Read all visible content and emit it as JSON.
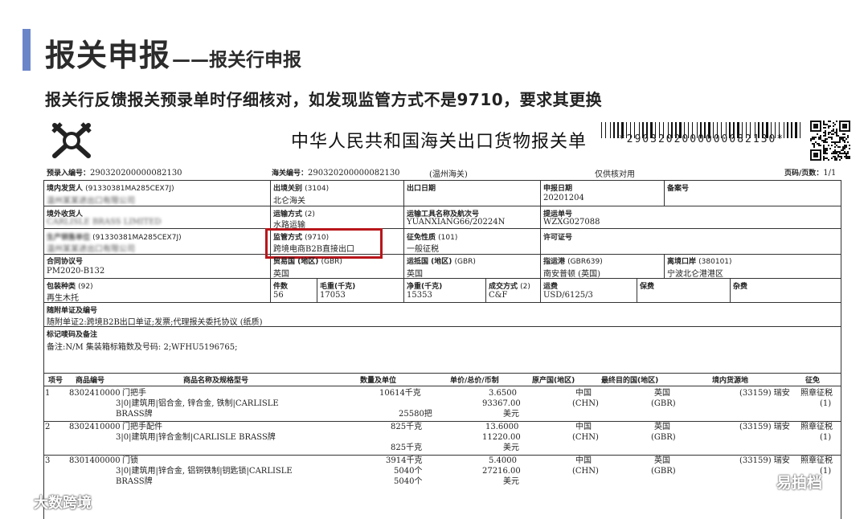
{
  "slide": {
    "title_main": "报关申报",
    "title_sub": "——报关行申报",
    "instruction": "报关行反馈报关预录单时仔细核对，如发现监管方式不是9710，要求其更换"
  },
  "doc": {
    "title": "中华人民共和国海关出口货物报关单",
    "barcode_text": "*2903202000000082130*",
    "prerecord_label": "预录入编号：",
    "prerecord_no": "290320200000082130",
    "customs_no_label": "海关编号：",
    "customs_no": "290320200000082130",
    "customs_office": "(温州海关)",
    "notice": "仅供核对用",
    "page_label": "页码/页数：",
    "page_value": "1/1",
    "fields": {
      "domestic_consignor_label": "境内发货人",
      "domestic_consignor_code": "(91330381MA285CEX7J)",
      "domestic_consignor_name": "温州某某进出口有限公司",
      "export_port_label": "出境关别",
      "export_port_code": "(3104)",
      "export_port_value": "北仑海关",
      "export_date_label": "出口日期",
      "declare_date_label": "申报日期",
      "declare_date_value": "20201204",
      "record_no_label": "备案号",
      "overseas_consignee_label": "境外收货人",
      "overseas_consignee_name": "CARLISLE BRASS LIMITED",
      "transport_mode_label": "运输方式",
      "transport_mode_code": "(2)",
      "transport_mode_value": "水路运输",
      "vessel_label": "运输工具名称及航次号",
      "vessel_value": "YUANXIANG66/20224N",
      "bl_label": "提运单号",
      "bl_value": "WZXG027088",
      "producer_label": "生产销售单位",
      "producer_code": "(91330381MA285CEX7J)",
      "producer_name": "温州某某进出口有限公司",
      "supervision_label": "监管方式",
      "supervision_code": "(9710)",
      "supervision_value": "跨境电商B2B直接出口",
      "levy_label": "征免性质",
      "levy_code": "(101)",
      "levy_value": "一般征税",
      "license_label": "许可证号",
      "contract_label": "合同协议号",
      "contract_value": "PM2020-B132",
      "trade_country_label": "贸易国 (地区)",
      "trade_country_code": "(GBR)",
      "trade_country_value": "英国",
      "dest_country_label": "运抵国 (地区)",
      "dest_country_code": "(GBR)",
      "dest_country_value": "英国",
      "dest_port_label": "指运港",
      "dest_port_code": "(GBR639)",
      "dest_port_value": "南安普顿 (英国)",
      "exit_port_label": "离境口岸",
      "exit_port_code": "(380101)",
      "exit_port_value": "宁波北仑港港区",
      "package_label": "包装种类",
      "package_code": "(92)",
      "package_value": "再生木托",
      "pieces_label": "件数",
      "pieces_value": "56",
      "gross_label": "毛重(千克)",
      "gross_value": "17053",
      "net_label": "净重(千克)",
      "net_value": "15353",
      "deal_mode_label": "成交方式",
      "deal_mode_code": "(2)",
      "deal_mode_value": "C&F",
      "freight_label": "运费",
      "freight_value": "USD/6125/3",
      "insurance_label": "保费",
      "misc_label": "杂费",
      "attached_label": "随附单证及编号",
      "attached_value": "随附单证2:跨境B2B出口单证;发票;代理报关委托协议 (纸质)",
      "marks_label": "标记唛码及备注",
      "marks_value": "备注:N/M  集装箱标箱数及号码: 2;WFHU5196765;"
    },
    "goods_headers": [
      "项号",
      "商品编号",
      "商品名称及规格型号",
      "数量及单位",
      "单价/总价/币制",
      "原产国(地区)",
      "最终目的国(地区)",
      "境内货源地",
      "征免"
    ],
    "goods": [
      {
        "no": "1",
        "code": "8302410000",
        "name1": "门把手",
        "name2": "3|0|建筑用|铝合金, 锌合金, 铁制|CARLISLE",
        "name3": "BRASS牌",
        "qty1": "10614千克",
        "qty2": "25580把",
        "price": "3.6500",
        "total": "93367.00",
        "currency": "美元",
        "origin": "中国",
        "origin_code": "(CHN)",
        "dest": "英国",
        "dest_code": "(GBR)",
        "source": "(33159) 瑞安",
        "levy": "照章征税",
        "levy_code": "(1)"
      },
      {
        "no": "2",
        "code": "8302410000",
        "name1": "门把手配件",
        "name2": "3|0|建筑用|锌合金制|CARLISLE BRASS牌",
        "name3": "",
        "qty1": "825千克",
        "qty2": "825千克",
        "price": "13.6000",
        "total": "11220.00",
        "currency": "美元",
        "origin": "中国",
        "origin_code": "(CHN)",
        "dest": "英国",
        "dest_code": "(GBR)",
        "source": "(33159) 瑞安",
        "levy": "照章征税",
        "levy_code": "(1)"
      },
      {
        "no": "3",
        "code": "8301400000",
        "name1": "门锁",
        "name2": "3|0|建筑用|锌合金, 铝铜铁制|钥匙锁|CARLISLE",
        "name3": "BRASS牌",
        "qty1": "3914千克",
        "qty2": "5040个",
        "qty3": "5040个",
        "price": "5.4000",
        "total": "27216.00",
        "currency": "美元",
        "origin": "中国",
        "origin_code": "(CHN)",
        "dest": "英国",
        "dest_code": "(GBR)",
        "source": "(33159) 瑞安",
        "levy": "照章征税",
        "levy_code": "(1)"
      }
    ]
  },
  "brands": {
    "left": "大数跨境",
    "right": "易拍档"
  },
  "colors": {
    "accent": "#6b86c8",
    "highlight": "#b8161b"
  }
}
